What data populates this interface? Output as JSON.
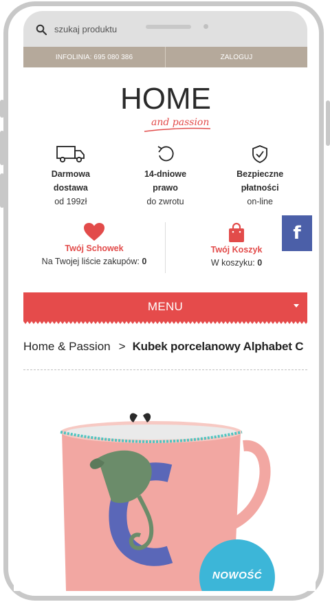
{
  "search": {
    "placeholder": "szukaj produktu",
    "icon": "search-icon"
  },
  "info_bar": {
    "hotline": "INFOLINIA: 695 080 386",
    "login": "ZALOGUJ"
  },
  "logo": {
    "main": "HOME",
    "sub": "and passion"
  },
  "features": [
    {
      "icon": "truck-icon",
      "title_line1": "Darmowa",
      "title_line2": "dostawa",
      "sub": "od 199zł"
    },
    {
      "icon": "return-arrow-icon",
      "title_line1": "14-dniowe",
      "title_line2": "prawo",
      "sub": "do zwrotu"
    },
    {
      "icon": "shield-check-icon",
      "title_line1": "Bezpieczne",
      "title_line2": "płatności",
      "sub": "on-line"
    }
  ],
  "facebook": {
    "label": "f"
  },
  "wishlist": {
    "icon": "heart-icon",
    "title": "Twój Schowek",
    "sub_prefix": "Na Twojej liście zakupów:",
    "count": "0"
  },
  "cart": {
    "icon": "shopping-bag-icon",
    "title": "Twój Koszyk",
    "sub_prefix": "W koszyku:",
    "count": "0"
  },
  "menu": {
    "label": "MENU"
  },
  "breadcrumb": {
    "home": "Home & Passion",
    "separator": ">",
    "current": "Kubek porcelanowy Alphabet C"
  },
  "product": {
    "badge": "NOWOŚĆ"
  },
  "colors": {
    "accent_red": "#e54b4b",
    "info_bar": "#b5a99b",
    "facebook": "#4b5fa8",
    "badge": "#3cb6d8",
    "mug_pink": "#f2a7a2"
  }
}
